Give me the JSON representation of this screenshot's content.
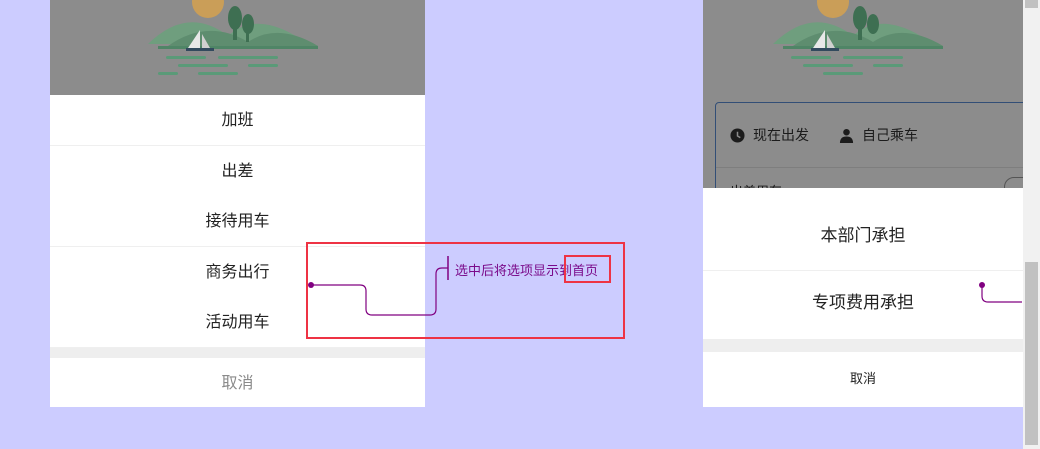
{
  "left_screen": {
    "action_sheet": {
      "items": [
        "加班",
        "出差",
        "接待用车",
        "商务出行",
        "活动用车"
      ],
      "cancel_label": "取消"
    }
  },
  "annotation": {
    "text_main": "选中后将选项显示",
    "text_highlight": "到首页",
    "line_color": "#800080",
    "box_color": "#ee3344"
  },
  "right_screen": {
    "card": {
      "time_option": "现在出发",
      "rider_option": "自己乘车",
      "partial_label": "出差用车"
    },
    "action_sheet": {
      "items": [
        "本部门承担",
        "专项费用承担"
      ],
      "cancel_label": "取消"
    }
  },
  "colors": {
    "background": "#ccccff",
    "overlay": "#8c8c8c",
    "card_border": "#5b8fd8"
  }
}
